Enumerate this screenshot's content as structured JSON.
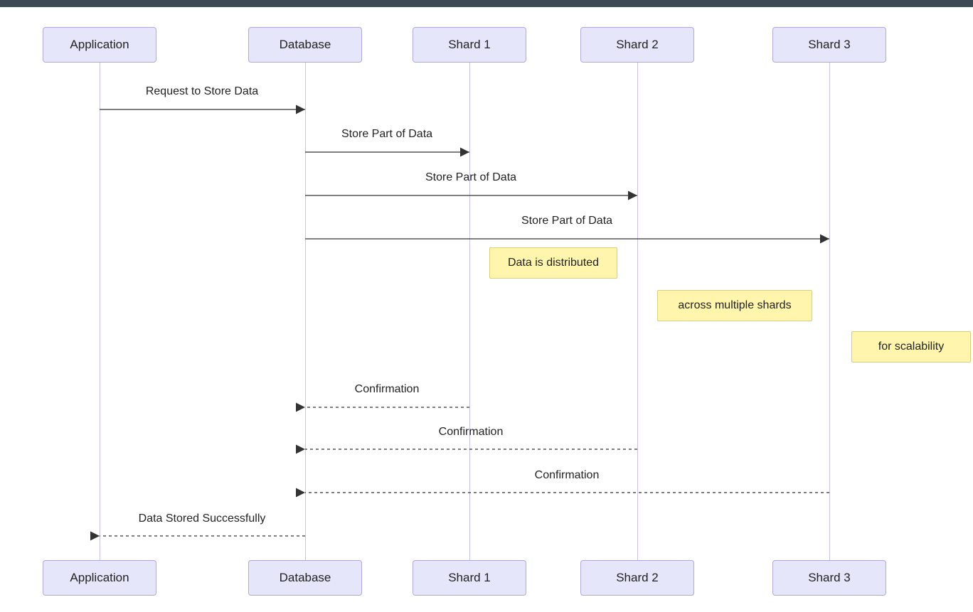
{
  "diagram_type": "sequence",
  "participants": [
    "Application",
    "Database",
    "Shard 1",
    "Shard 2",
    "Shard 3"
  ],
  "messages": [
    {
      "from": "Application",
      "to": "Database",
      "label": "Request to Store Data",
      "style": "solid"
    },
    {
      "from": "Database",
      "to": "Shard 1",
      "label": "Store Part of Data",
      "style": "solid"
    },
    {
      "from": "Database",
      "to": "Shard 2",
      "label": "Store Part of Data",
      "style": "solid"
    },
    {
      "from": "Database",
      "to": "Shard 3",
      "label": "Store Part of Data",
      "style": "solid"
    },
    {
      "from": "Shard 1",
      "to": "Database",
      "label": "Confirmation",
      "style": "dashed"
    },
    {
      "from": "Shard 2",
      "to": "Database",
      "label": "Confirmation",
      "style": "dashed"
    },
    {
      "from": "Shard 3",
      "to": "Database",
      "label": "Confirmation",
      "style": "dashed"
    },
    {
      "from": "Database",
      "to": "Application",
      "label": "Data Stored Successfully",
      "style": "dashed"
    }
  ],
  "notes": [
    {
      "over": "Shard 1",
      "text": "Data is distributed"
    },
    {
      "over": "Shard 2",
      "text": "across multiple shards"
    },
    {
      "over": "Shard 3",
      "text": "for scalability"
    }
  ],
  "colors": {
    "participant_fill": "#e6e6fa",
    "participant_border": "#b0a8d9",
    "note_fill": "#fff5ad",
    "note_border": "#d9cf7a",
    "line": "#333333",
    "lifeline": "#c9c3e6",
    "topbar": "#3b4a54"
  }
}
